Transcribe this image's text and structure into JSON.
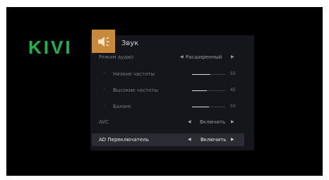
{
  "brand": {
    "logo": "KIVI"
  },
  "colors": {
    "brand_green": "#22b14c",
    "header_accent": "#c8893c",
    "panel_bg": "#14161c",
    "selected_row_bg": "#2a2c33"
  },
  "menu": {
    "title": "Звук",
    "header_icon": "speaker-icon",
    "rows": {
      "audio_mode": {
        "label": "Режим аудио",
        "value": "Расширенный"
      },
      "bass": {
        "label": "Низкие частоты",
        "value": "55",
        "level": 55,
        "icon": "bass-icon"
      },
      "treble": {
        "label": "Высокие частоты",
        "value": "45",
        "level": 45,
        "icon": "treble-icon"
      },
      "balance": {
        "label": "Баланс",
        "value": "50",
        "level": 50,
        "icon": "balance-icon"
      },
      "avc": {
        "label": "AVC",
        "value": "Включить"
      },
      "ad_switch": {
        "label": "AD Переключатель",
        "value": "Включить"
      }
    }
  }
}
